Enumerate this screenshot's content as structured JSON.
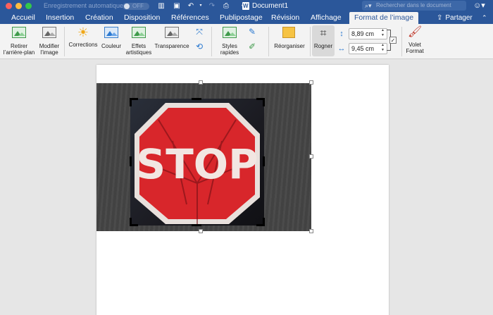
{
  "titlebar": {
    "autosave_label": "Enregistrement automatique",
    "toggle_label": "OFF",
    "doc_title": "Document1",
    "search_placeholder": "Rechercher dans le document"
  },
  "tabs": {
    "items": [
      {
        "label": "Accueil"
      },
      {
        "label": "Insertion"
      },
      {
        "label": "Création"
      },
      {
        "label": "Disposition"
      },
      {
        "label": "Références"
      },
      {
        "label": "Publipostage"
      },
      {
        "label": "Révision"
      },
      {
        "label": "Affichage"
      },
      {
        "label": "Format de l’image"
      }
    ],
    "active_index": 8,
    "share_label": "Partager"
  },
  "ribbon": {
    "remove_bg": {
      "line1": "Retirer",
      "line2": "l’arrière-plan"
    },
    "modify_image": {
      "line1": "Modifier",
      "line2": "l’image"
    },
    "corrections": "Corrections",
    "color": "Couleur",
    "artistic": {
      "line1": "Effets",
      "line2": "artistiques"
    },
    "transparency": "Transparence",
    "quick_styles": {
      "line1": "Styles",
      "line2": "rapides"
    },
    "arrange": "Réorganiser",
    "crop": "Rogner",
    "height": "8,89 cm",
    "width": "9,45 cm",
    "format_pane": {
      "line1": "Volet",
      "line2": "Format"
    }
  },
  "document": {
    "image_text": "STOP"
  },
  "colors": {
    "brand": "#2b579a",
    "ribbon_bg": "#f3f3f3",
    "stop_red": "#d8262b"
  }
}
